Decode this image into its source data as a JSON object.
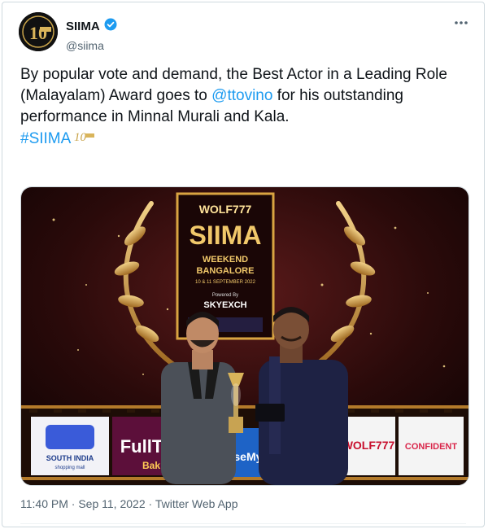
{
  "author": {
    "display_name": "SIIMA",
    "handle": "@siima",
    "verified_badge_color": "#1d9bf0"
  },
  "tweet": {
    "text_part1": "By popular vote and demand, the Best Actor in a Leading Role (Malayalam) Award goes to ",
    "mention": "@ttovino",
    "text_part2": "  for his outstanding performance in Minnal Murali and Kala.",
    "hashtag": "#SIIMA"
  },
  "media": {
    "backdrop": {
      "brand": "WOLF777",
      "title": "SIIMA",
      "subtitle1": "WEEKEND",
      "subtitle2": "BANGALORE",
      "date_line": "10 & 11 SEPTEMBER 2022",
      "powered_by": "Powered By",
      "sponsor": "SKYEXCH"
    },
    "banners": [
      "SOUTH INDIA",
      "shopping mall",
      "FullT",
      "Bak",
      "aseMy",
      "WOLF777",
      "CONFIDENT"
    ]
  },
  "meta": {
    "time": "11:40 PM",
    "separator": " · ",
    "date": "Sep 11, 2022",
    "source": "Twitter Web App"
  },
  "colors": {
    "link": "#1d9bf0",
    "muted": "#536471",
    "gold": "#d9a441"
  },
  "icons": {
    "verified": "verified-badge-icon",
    "more": "more-icon"
  }
}
